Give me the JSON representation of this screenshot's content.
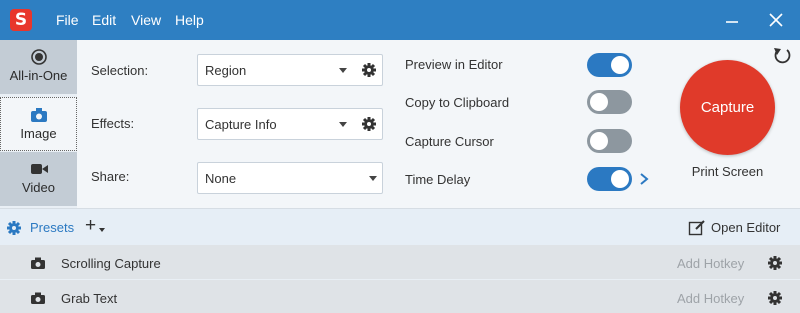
{
  "app": {
    "logo_letter": "S",
    "menu": [
      "File",
      "Edit",
      "View",
      "Help"
    ],
    "accent": "#2e7fc2",
    "capture_color": "#e03a2a"
  },
  "sidebar": {
    "items": [
      {
        "label": "All-in-One",
        "icon": "all-in-one-icon"
      },
      {
        "label": "Image",
        "icon": "camera-icon",
        "selected": true
      },
      {
        "label": "Video",
        "icon": "video-camera-icon"
      }
    ]
  },
  "settings": {
    "selection_label": "Selection:",
    "selection_value": "Region",
    "effects_label": "Effects:",
    "effects_value": "Capture Info",
    "share_label": "Share:",
    "share_value": "None"
  },
  "toggles": [
    {
      "label": "Preview in Editor",
      "on": true
    },
    {
      "label": "Copy to Clipboard",
      "on": false
    },
    {
      "label": "Capture Cursor",
      "on": false
    },
    {
      "label": "Time Delay",
      "on": true
    }
  ],
  "capture": {
    "button_label": "Capture",
    "hotkey": "Print Screen"
  },
  "presets": {
    "label": "Presets",
    "add_label": "+",
    "open_editor": "Open Editor",
    "items": [
      {
        "name": "Scrolling Capture",
        "hotkey": "Add Hotkey"
      },
      {
        "name": "Grab Text",
        "hotkey": "Add Hotkey"
      }
    ]
  }
}
